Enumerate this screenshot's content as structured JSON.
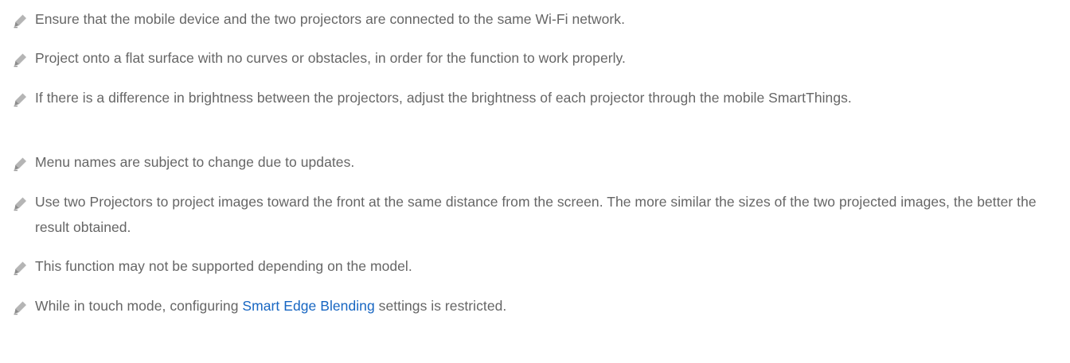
{
  "notes": [
    {
      "icon": "pencil-icon",
      "text": "Ensure that the mobile device and the two projectors are connected to the same Wi-Fi network."
    },
    {
      "icon": "pencil-icon",
      "text": "Project onto a flat surface with no curves or obstacles, in order for the function to work properly."
    },
    {
      "icon": "pencil-icon",
      "text": "If there is a difference in brightness between the projectors, adjust the brightness of each projector through the mobile SmartThings."
    },
    {
      "icon": "pencil-icon",
      "text": "Menu names are subject to change due to updates."
    },
    {
      "icon": "pencil-icon",
      "text": "Use two Projectors to project images toward the front at the same distance from the screen. The more similar the sizes of the two projected images, the better the result obtained."
    },
    {
      "icon": "pencil-icon",
      "text": "This function may not be supported depending on the model."
    },
    {
      "icon": "pencil-icon",
      "text_before": "While in touch mode, configuring ",
      "link": "Smart Edge Blending",
      "text_after": " settings is restricted."
    }
  ],
  "colors": {
    "text": "#666666",
    "link": "#1766c2",
    "icon": "#a9a9a9"
  }
}
